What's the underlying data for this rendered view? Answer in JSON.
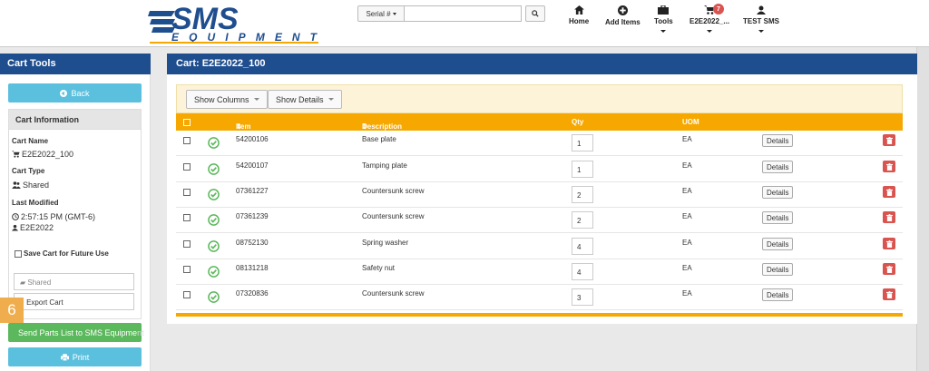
{
  "header": {
    "logo_text_top": "SMS",
    "logo_text_bottom": "EQUIPMENT",
    "serial_select": "Serial #",
    "search_placeholder": "",
    "nav": [
      {
        "label": "Home",
        "icon": "home-icon"
      },
      {
        "label": "Add Items",
        "icon": "plus-circle-icon"
      },
      {
        "label": "Tools",
        "icon": "briefcase-icon"
      },
      {
        "label": "E2E2022_...",
        "icon": "cart-icon",
        "badge": "7"
      },
      {
        "label": "TEST SMS",
        "icon": "user-icon"
      }
    ]
  },
  "sidebar": {
    "title": "Cart Tools",
    "back_label": "Back",
    "info_title": "Cart Information",
    "cart_name_label": "Cart Name",
    "cart_name": "E2E2022_100",
    "cart_type_label": "Cart Type",
    "cart_type": "Shared",
    "last_modified_label": "Last Modified",
    "last_modified_time": "2:57:15 PM (GMT-6)",
    "last_modified_user": "E2E2022",
    "save_label": "Save Cart for Future Use",
    "shared_field": "Shared",
    "export_label": "Export Cart",
    "send_label": "Send Parts List to SMS Equipme",
    "send_overflow": "nt",
    "print_label": "Print",
    "step_badge": "6"
  },
  "main": {
    "title": "Cart: E2E2022_100",
    "show_columns": "Show Columns",
    "show_details": "Show Details",
    "columns": {
      "item": "Item",
      "description": "Description",
      "qty": "Qty",
      "uom": "UOM"
    },
    "rows": [
      {
        "item": "54200106",
        "description": "Base plate",
        "qty": "1",
        "uom": "EA",
        "details": "Details"
      },
      {
        "item": "54200107",
        "description": "Tamping plate",
        "qty": "1",
        "uom": "EA",
        "details": "Details"
      },
      {
        "item": "07361227",
        "description": "Countersunk screw",
        "qty": "2",
        "uom": "EA",
        "details": "Details"
      },
      {
        "item": "07361239",
        "description": "Countersunk screw",
        "qty": "2",
        "uom": "EA",
        "details": "Details"
      },
      {
        "item": "08752130",
        "description": "Spring washer",
        "qty": "4",
        "uom": "EA",
        "details": "Details"
      },
      {
        "item": "08131218",
        "description": "Safety nut",
        "qty": "4",
        "uom": "EA",
        "details": "Details"
      },
      {
        "item": "07320836",
        "description": "Countersunk screw",
        "qty": "3",
        "uom": "EA",
        "details": "Details"
      }
    ]
  },
  "colors": {
    "navy": "#1f4e8f",
    "orange": "#f6a800",
    "info": "#5bc0de",
    "success": "#5cb85c",
    "danger": "#d9534f"
  }
}
